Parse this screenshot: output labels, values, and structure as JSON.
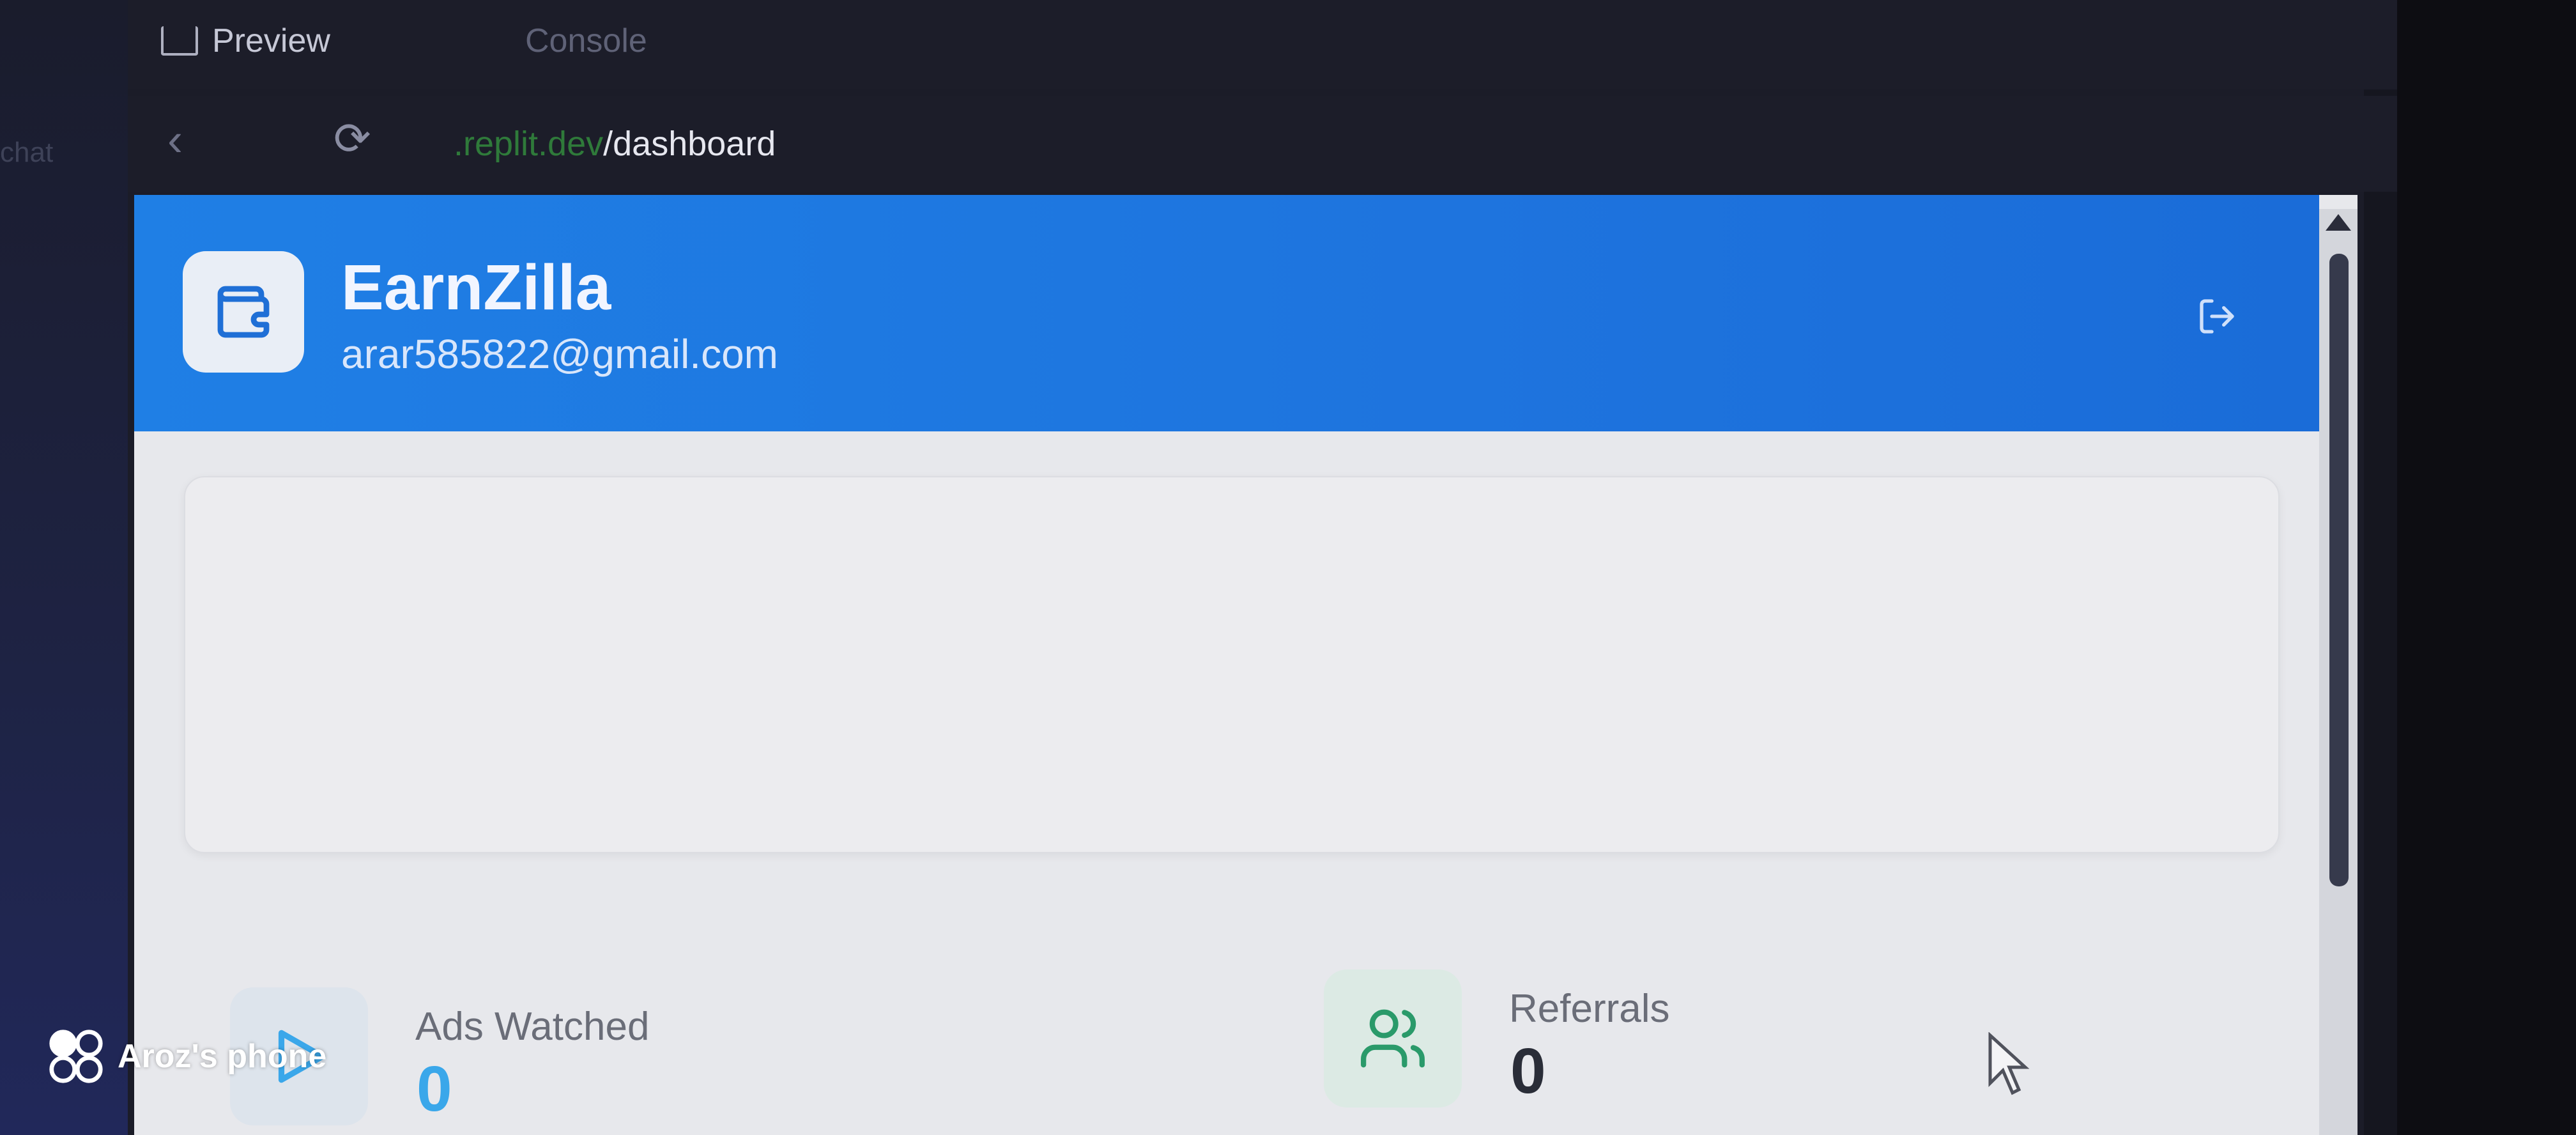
{
  "ide": {
    "tabs": [
      {
        "label": "Preview",
        "icon": "preview-icon"
      },
      {
        "label": "Console"
      }
    ],
    "side_label": "chat",
    "url": {
      "domain": ".replit.dev",
      "path": "/dashboard"
    }
  },
  "app": {
    "name": "EarnZilla",
    "email": "arar585822@gmail.com",
    "accent_color": "#1f7fe5",
    "logo_icon": "wallet-icon",
    "logout_icon": "logout-icon"
  },
  "stats": [
    {
      "label": "Ads Watched",
      "value": "0",
      "icon": "play-icon",
      "color": "#3aa7ea"
    },
    {
      "label": "Referrals",
      "value": "0",
      "icon": "users-icon",
      "color": "#2a9a6a"
    }
  ],
  "watermark": {
    "text": "Aroz's phone"
  }
}
